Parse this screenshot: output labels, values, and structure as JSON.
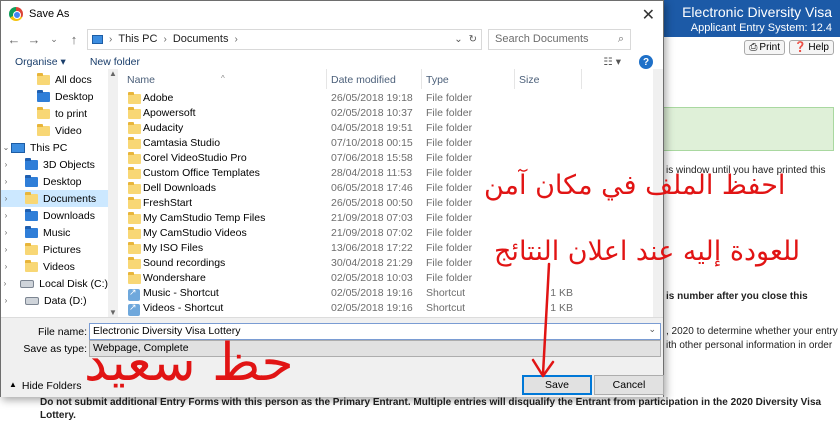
{
  "background_page": {
    "header_title": "Electronic Diversity Visa",
    "header_sub": "Applicant Entry System: 12.4",
    "print_btn": "Print",
    "help_btn": "Help",
    "line1": "is window until you have printed this",
    "line2": "is number after you close this",
    "line3": ", 2020 to determine whether your entry",
    "line4": "ith other personal information in order",
    "line5": "Do not submit additional Entry Forms with this person as the Primary Entrant. Multiple entries will disqualify the Entrant from participation in the 2020 Diversity Visa",
    "line6": "Lottery."
  },
  "dialog": {
    "title": "Save As",
    "breadcrumb": [
      "This PC",
      "Documents"
    ],
    "search_placeholder": "Search Documents",
    "toolbar": {
      "organise": "Organise",
      "new_folder": "New folder"
    },
    "tree": [
      {
        "label": "All docs",
        "icon": "folder",
        "indent": 1
      },
      {
        "label": "Desktop",
        "icon": "folder-blue",
        "indent": 1
      },
      {
        "label": "to print",
        "icon": "folder",
        "indent": 1
      },
      {
        "label": "Video",
        "icon": "folder",
        "indent": 1
      },
      {
        "label": "This PC",
        "icon": "pc",
        "indent": 0
      },
      {
        "label": "3D Objects",
        "icon": "folder-blue",
        "indent": 1
      },
      {
        "label": "Desktop",
        "icon": "folder-blue",
        "indent": 1
      },
      {
        "label": "Documents",
        "icon": "folder",
        "indent": 1
      },
      {
        "label": "Downloads",
        "icon": "folder-blue",
        "indent": 1
      },
      {
        "label": "Music",
        "icon": "folder-blue",
        "indent": 1
      },
      {
        "label": "Pictures",
        "icon": "folder",
        "indent": 1
      },
      {
        "label": "Videos",
        "icon": "folder",
        "indent": 1
      },
      {
        "label": "Local Disk (C:)",
        "icon": "disk",
        "indent": 1
      },
      {
        "label": "Data (D:)",
        "icon": "disk",
        "indent": 1
      }
    ],
    "tree_selected_index": 7,
    "columns": {
      "name": "Name",
      "date": "Date modified",
      "type": "Type",
      "size": "Size"
    },
    "files": [
      {
        "name": "Adobe",
        "date": "26/05/2018 19:18",
        "type": "File folder",
        "size": ""
      },
      {
        "name": "Apowersoft",
        "date": "02/05/2018 10:37",
        "type": "File folder",
        "size": ""
      },
      {
        "name": "Audacity",
        "date": "04/05/2018 19:51",
        "type": "File folder",
        "size": ""
      },
      {
        "name": "Camtasia Studio",
        "date": "07/10/2018 00:15",
        "type": "File folder",
        "size": ""
      },
      {
        "name": "Corel VideoStudio Pro",
        "date": "07/06/2018 15:58",
        "type": "File folder",
        "size": ""
      },
      {
        "name": "Custom Office Templates",
        "date": "28/04/2018 11:53",
        "type": "File folder",
        "size": ""
      },
      {
        "name": "Dell Downloads",
        "date": "06/05/2018 17:46",
        "type": "File folder",
        "size": ""
      },
      {
        "name": "FreshStart",
        "date": "26/05/2018 00:50",
        "type": "File folder",
        "size": ""
      },
      {
        "name": "My CamStudio Temp Files",
        "date": "21/09/2018 07:03",
        "type": "File folder",
        "size": ""
      },
      {
        "name": "My CamStudio Videos",
        "date": "21/09/2018 07:02",
        "type": "File folder",
        "size": ""
      },
      {
        "name": "My ISO Files",
        "date": "13/06/2018 17:22",
        "type": "File folder",
        "size": ""
      },
      {
        "name": "Sound recordings",
        "date": "30/04/2018 21:29",
        "type": "File folder",
        "size": ""
      },
      {
        "name": "Wondershare",
        "date": "02/05/2018 10:03",
        "type": "File folder",
        "size": ""
      },
      {
        "name": "Music - Shortcut",
        "date": "02/05/2018 19:16",
        "type": "Shortcut",
        "size": "1 KB"
      },
      {
        "name": "Videos - Shortcut",
        "date": "02/05/2018 19:16",
        "type": "Shortcut",
        "size": "1 KB"
      }
    ],
    "file_name_label": "File name:",
    "file_name_value": "Electronic Diversity Visa Lottery",
    "save_type_label": "Save as type:",
    "save_type_value": "Webpage, Complete",
    "hide_folders": "Hide Folders",
    "save_button": "Save",
    "cancel_button": "Cancel"
  },
  "annotations": {
    "line1": "احفظ الملف في مكان آمن",
    "line2": "للعودة إليه عند اعلان النتائج",
    "good_luck": "حظ سعيد",
    "color": "#e11414"
  }
}
